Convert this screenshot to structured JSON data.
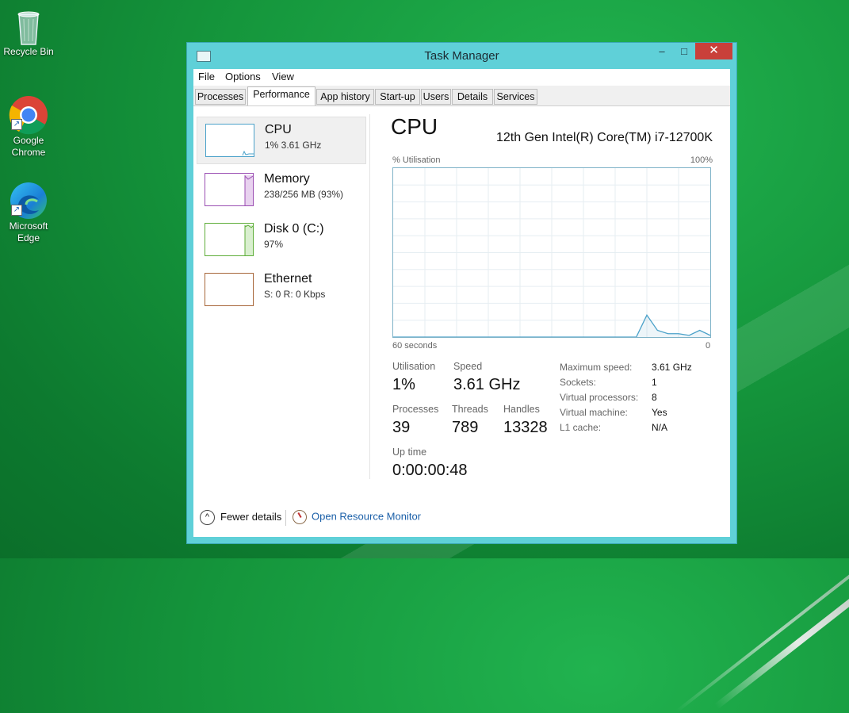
{
  "desktop": {
    "icons": [
      {
        "label": "Recycle Bin",
        "icon": "recycle-bin-icon"
      },
      {
        "label": "Google Chrome",
        "icon": "chrome-icon"
      },
      {
        "label": "Microsoft Edge",
        "icon": "edge-icon"
      }
    ]
  },
  "window": {
    "title": "Task Manager",
    "controls": {
      "minimize": "–",
      "maximize": "□",
      "close": "✕"
    },
    "menu": [
      "File",
      "Options",
      "View"
    ],
    "tabs": [
      "Processes",
      "Performance",
      "App history",
      "Start-up",
      "Users",
      "Details",
      "Services"
    ],
    "active_tab": "Performance"
  },
  "resources": [
    {
      "name": "CPU",
      "detail": "1% 3.61 GHz",
      "color": "#4aa1c9",
      "selected": true
    },
    {
      "name": "Memory",
      "detail": "238/256 MB (93%)",
      "color": "#9b4fb3",
      "selected": false
    },
    {
      "name": "Disk 0 (C:)",
      "detail": "97%",
      "color": "#5fae3a",
      "selected": false
    },
    {
      "name": "Ethernet",
      "detail": "S: 0 R: 0 Kbps",
      "color": "#a7663a",
      "selected": false
    }
  ],
  "detail": {
    "title": "CPU",
    "model": "12th Gen Intel(R) Core(TM) i7-12700K",
    "y_label": "% Utilisation",
    "y_max": "100%",
    "x_left": "60 seconds",
    "x_right": "0",
    "stats": {
      "utilisation_label": "Utilisation",
      "utilisation": "1%",
      "speed_label": "Speed",
      "speed": "3.61 GHz",
      "processes_label": "Processes",
      "processes": "39",
      "threads_label": "Threads",
      "threads": "789",
      "handles_label": "Handles",
      "handles": "13328",
      "uptime_label": "Up time",
      "uptime": "0:00:00:48"
    },
    "specs": [
      {
        "label": "Maximum speed:",
        "value": "3.61 GHz"
      },
      {
        "label": "Sockets:",
        "value": "1"
      },
      {
        "label": "Virtual processors:",
        "value": "8"
      },
      {
        "label": "Virtual machine:",
        "value": "Yes"
      },
      {
        "label": "L1 cache:",
        "value": "N/A"
      }
    ]
  },
  "footer": {
    "fewer_details": "Fewer details",
    "open_resource_monitor": "Open Resource Monitor"
  },
  "chart_data": {
    "type": "line",
    "x": [
      60,
      14,
      12,
      10,
      8,
      6,
      4,
      2,
      0
    ],
    "series": [
      {
        "values": [
          0,
          0,
          13,
          4,
          2,
          2,
          1,
          4,
          1
        ]
      }
    ],
    "ylim": [
      0,
      100
    ],
    "xlim": [
      60,
      0
    ],
    "grid": true
  }
}
